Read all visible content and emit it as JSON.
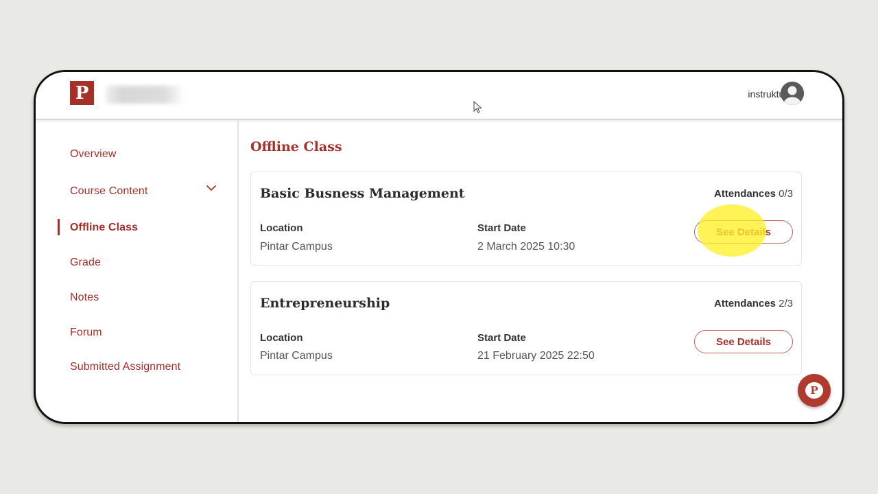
{
  "header": {
    "logo_letter": "P",
    "user_name": "instruktur"
  },
  "sidebar": {
    "items": [
      {
        "label": "Overview"
      },
      {
        "label": "Course Content"
      },
      {
        "label": "Offline Class"
      },
      {
        "label": "Grade"
      },
      {
        "label": "Notes"
      },
      {
        "label": "Forum"
      },
      {
        "label": "Submitted Assignment"
      }
    ],
    "active_item": "Offline Class"
  },
  "main": {
    "title": "Offline Class",
    "classes": [
      {
        "title": "Basic Busness Management",
        "attendance_label": "Attendances",
        "attendance_value": "0/3",
        "location_label": "Location",
        "location_value": "Pintar Campus",
        "start_label": "Start Date",
        "start_value": "2 March 2025 10:30",
        "button_label": "See Details"
      },
      {
        "title": "Entrepreneurship",
        "attendance_label": "Attendances",
        "attendance_value": "2/3",
        "location_label": "Location",
        "location_value": "Pintar Campus",
        "start_label": "Start Date",
        "start_value": "21 February 2025 22:50",
        "button_label": "See Details"
      }
    ]
  },
  "chat_fab": {
    "letter": "P"
  },
  "colors": {
    "brand": "#a5302a",
    "background": "#e9eae6",
    "highlight": "#fff028"
  }
}
